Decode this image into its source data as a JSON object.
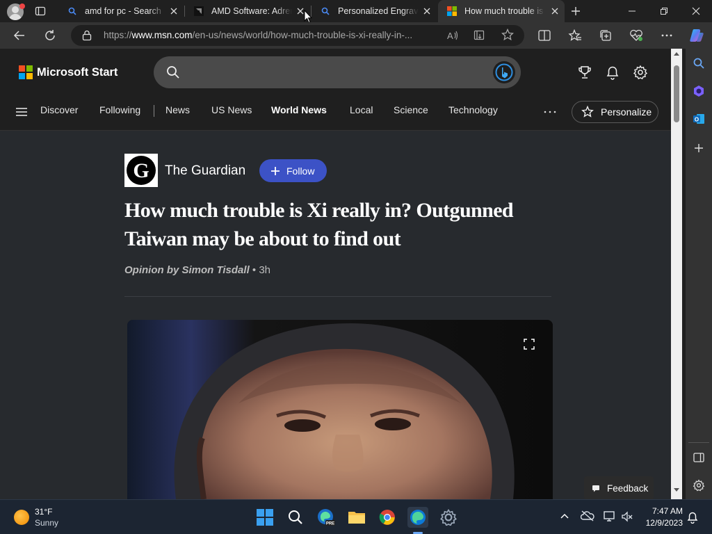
{
  "browser": {
    "tabs": [
      {
        "label": "amd for pc - Search",
        "icon": "search-favicon"
      },
      {
        "label": "AMD Software: Adren",
        "icon": "amd-favicon"
      },
      {
        "label": "Personalized Engraved",
        "icon": "search-favicon"
      },
      {
        "label": "How much trouble is Xi",
        "icon": "msn-favicon",
        "active": true
      }
    ],
    "url_prefix": "https://",
    "url_domain": "www.msn.com",
    "url_path": "/en-us/news/world/how-much-trouble-is-xi-really-in-..."
  },
  "site": {
    "brand": "Microsoft Start",
    "nav": [
      "Discover",
      "Following",
      "News",
      "US News",
      "World News",
      "Local",
      "Science",
      "Technology"
    ],
    "nav_active": "World News",
    "personalize_label": "Personalize"
  },
  "article": {
    "publisher": "The Guardian",
    "follow_label": "Follow",
    "headline_line1": "How much trouble is Xi really in? Outgunned",
    "headline_line2": "Taiwan may be about to find out",
    "byline": "Opinion by Simon Tisdall",
    "age": "3h",
    "feedback_label": "Feedback"
  },
  "taskbar": {
    "temperature": "31°F",
    "condition": "Sunny",
    "time": "7:47 AM",
    "date": "12/9/2023"
  },
  "colors": {
    "accent_blue": "#3c52c6",
    "page_bg": "#272a2e",
    "header_bg": "#1f1f1f"
  }
}
